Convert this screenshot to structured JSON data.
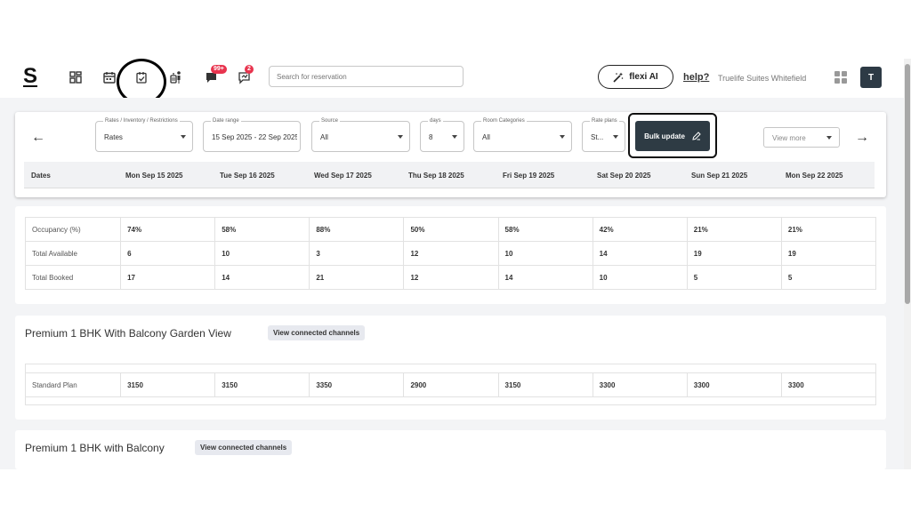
{
  "header": {
    "logo": "S",
    "notifications_badge": "99+",
    "messages_badge": "2",
    "search_placeholder": "Search for reservation",
    "flexi_label": "flexi AI",
    "help_label": "help?",
    "property_name": "Truelife Suites Whitefield",
    "avatar_initial": "T"
  },
  "filters": {
    "rates": {
      "label": "Rates / Inventory / Restrictions",
      "value": "Rates"
    },
    "date_range": {
      "label": "Date range",
      "value": "15 Sep 2025 - 22 Sep 2025"
    },
    "source": {
      "label": "Source",
      "value": "All"
    },
    "days": {
      "label": "days",
      "value": "8"
    },
    "room_categories": {
      "label": "Room Categories",
      "value": "All"
    },
    "rate_plans": {
      "label": "Rate plans",
      "value": "St..."
    },
    "bulk_update_label": "Bulk update",
    "view_more_label": "View more"
  },
  "dates_header": "Dates",
  "dates": [
    "Mon Sep 15 2025",
    "Tue Sep 16 2025",
    "Wed Sep 17 2025",
    "Thu Sep 18 2025",
    "Fri Sep 19 2025",
    "Sat Sep 20 2025",
    "Sun Sep 21 2025",
    "Mon Sep 22 2025"
  ],
  "occupancy_rows": [
    {
      "label": "Occupancy (%)",
      "values": [
        "74%",
        "58%",
        "88%",
        "50%",
        "58%",
        "42%",
        "21%",
        "21%"
      ]
    },
    {
      "label": "Total Available",
      "values": [
        "6",
        "10",
        "3",
        "12",
        "10",
        "14",
        "19",
        "19"
      ]
    },
    {
      "label": "Total Booked",
      "values": [
        "17",
        "14",
        "21",
        "12",
        "14",
        "10",
        "5",
        "5"
      ]
    }
  ],
  "rooms": [
    {
      "title": "Premium 1 BHK With Balcony Garden View",
      "chip": "View connected channels",
      "plan_label": "Standard Plan",
      "values": [
        "3150",
        "3150",
        "3350",
        "2900",
        "3150",
        "3300",
        "3300",
        "3300"
      ]
    },
    {
      "title": "Premium 1 BHK with Balcony",
      "chip": "View connected channels"
    }
  ]
}
